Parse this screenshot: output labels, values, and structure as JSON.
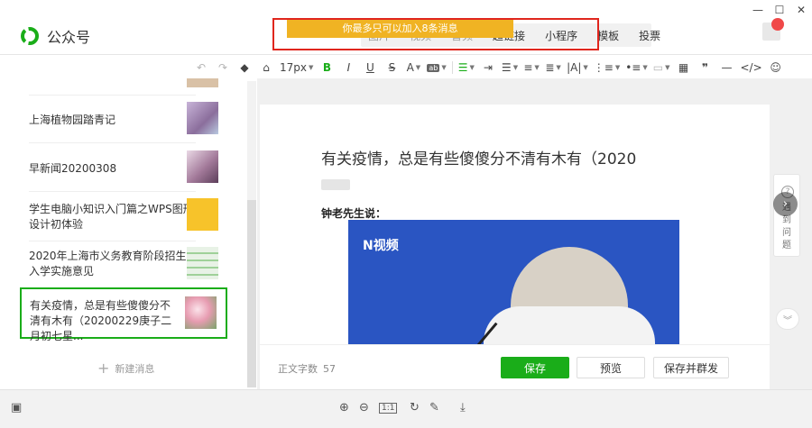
{
  "app": {
    "name": "公众号",
    "accent": "#1aad19"
  },
  "window_controls": [
    "minimize-icon",
    "maximize-icon",
    "close-icon"
  ],
  "top_nav": {
    "items": [
      "图片",
      "视频",
      "音频",
      "超链接",
      "小程序",
      "模板",
      "投票"
    ]
  },
  "toast": {
    "message": "你最多只可以加入8条消息",
    "color": "#f0b323"
  },
  "toolbar": {
    "font_size": "17px",
    "bold": "B",
    "italic": "I",
    "underline": "U",
    "strike": "S",
    "font_color": "A",
    "bg_color": "ab",
    "quote": "❞"
  },
  "articles": [
    {
      "title": "上海植物园踏青记"
    },
    {
      "title": "早新闻20200308"
    },
    {
      "title": "学生电脑小知识入门篇之WPS图形设计初体验"
    },
    {
      "title": "2020年上海市义务教育阶段招生入学实施意见"
    },
    {
      "title": "有关疫情，总是有些傻傻分不清有木有（20200229庚子二月初七星..."
    }
  ],
  "new_message": "新建消息",
  "editor": {
    "title": "有关疫情，总是有些傻傻分不清有木有（2020",
    "speaker": "钟老先生说：",
    "photo_logo": "N视频"
  },
  "side_widget": {
    "label": "遇到问题"
  },
  "bottom": {
    "word_count_label": "正文字数",
    "word_count": "57",
    "save": "保存",
    "preview": "预览",
    "save_send": "保存并群发"
  },
  "viewer_bar": {
    "zoom_box": "1:1"
  }
}
